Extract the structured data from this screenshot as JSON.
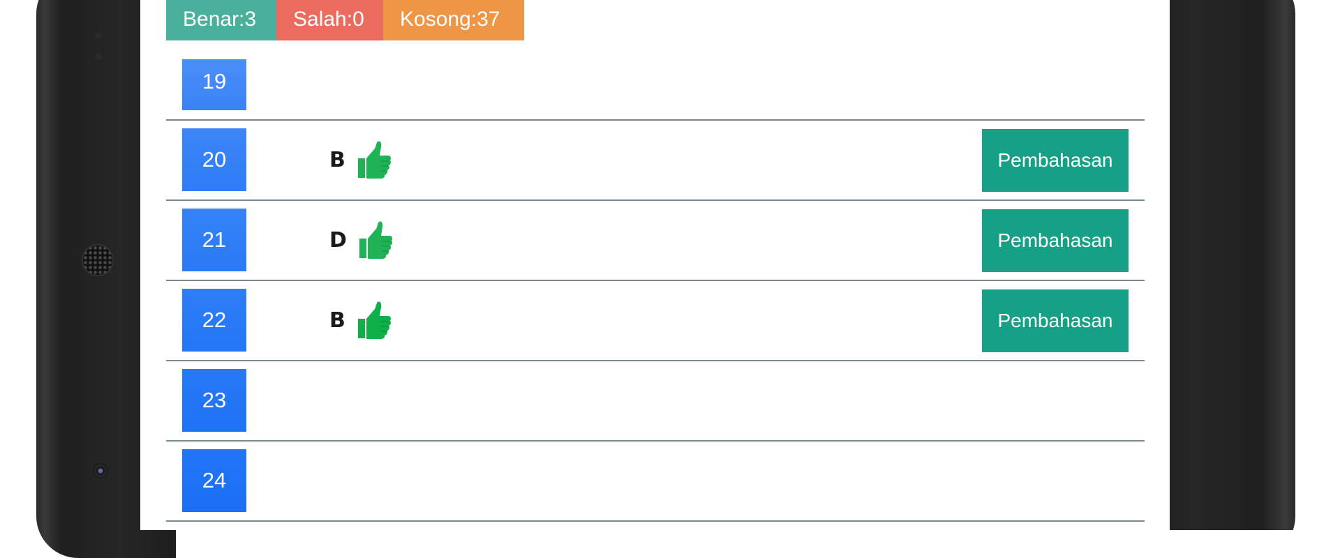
{
  "summary": {
    "benar": "Benar:3",
    "salah": "Salah:0",
    "kosong": "Kosong:37"
  },
  "colors": {
    "benar": "#48b09b",
    "salah": "#ec6b5f",
    "kosong": "#ee9546",
    "number_box": "#2f7cf6",
    "pembahasan_button": "#16a085",
    "thumb": "#1fb356"
  },
  "rows": [
    {
      "number": "19",
      "answer": "",
      "correct": false,
      "button": ""
    },
    {
      "number": "20",
      "answer": "B",
      "correct": true,
      "button": "Pembahasan"
    },
    {
      "number": "21",
      "answer": "D",
      "correct": true,
      "button": "Pembahasan"
    },
    {
      "number": "22",
      "answer": "B",
      "correct": true,
      "button": "Pembahasan"
    },
    {
      "number": "23",
      "answer": "",
      "correct": false,
      "button": ""
    },
    {
      "number": "24",
      "answer": "",
      "correct": false,
      "button": ""
    }
  ],
  "icons": {
    "correct": "thumbs-up-icon"
  }
}
